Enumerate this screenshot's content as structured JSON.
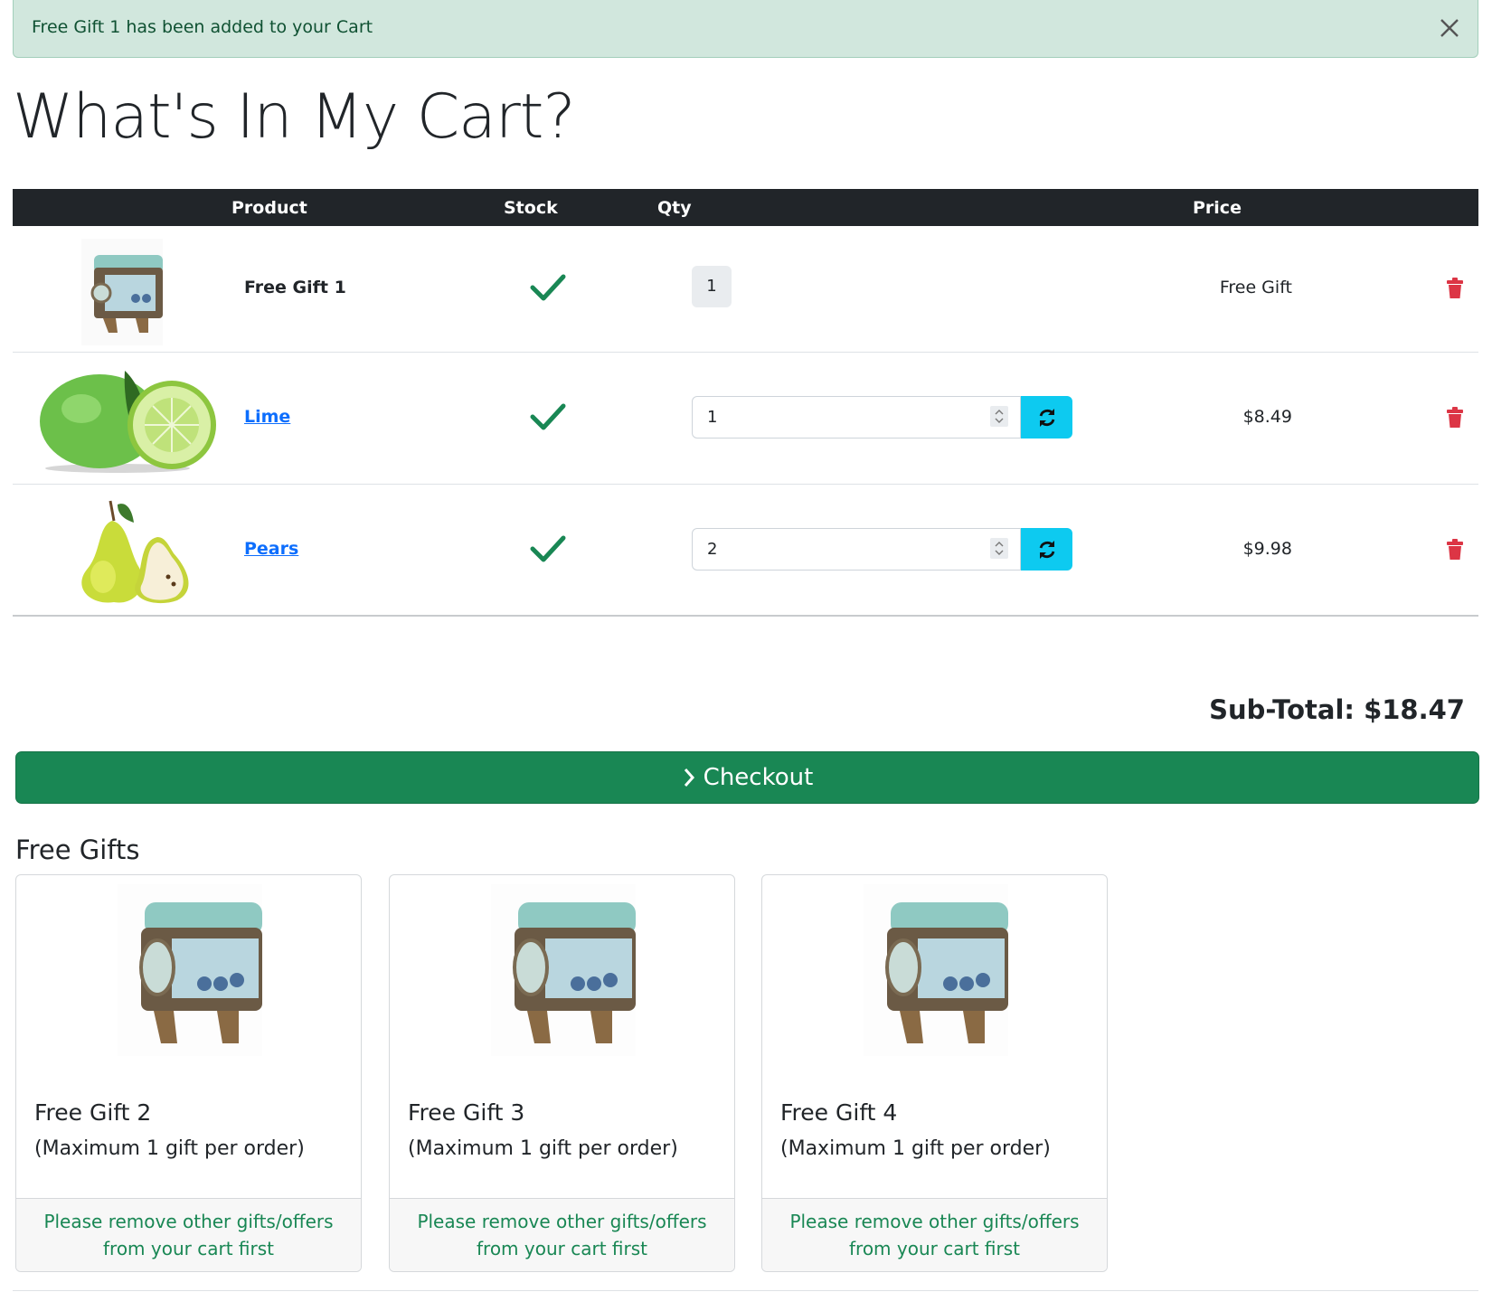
{
  "alert": {
    "message": "Free Gift 1 has been added to your Cart",
    "close_icon": "close-icon"
  },
  "page_title": "What's In My Cart?",
  "table": {
    "headers": {
      "product": "Product",
      "stock": "Stock",
      "qty": "Qty",
      "price": "Price"
    },
    "rows": [
      {
        "name": "Free Gift 1",
        "image": "jewelry-box",
        "in_stock": true,
        "qty": "1",
        "qty_editable": false,
        "price": "Free Gift"
      },
      {
        "name": "Lime",
        "image": "lime",
        "in_stock": true,
        "qty": "1",
        "qty_editable": true,
        "price": "$8.49"
      },
      {
        "name": "Pears",
        "image": "pear",
        "in_stock": true,
        "qty": "2",
        "qty_editable": true,
        "price": "$9.98"
      }
    ]
  },
  "subtotal": "Sub-Total: $18.47",
  "checkout_label": "Checkout",
  "free_gifts": {
    "title": "Free Gifts",
    "cards": [
      {
        "title": "Free Gift 2",
        "subtitle": "(Maximum 1 gift per order)",
        "footer": "Please remove other gifts/offers from your cart first"
      },
      {
        "title": "Free Gift 3",
        "subtitle": "(Maximum 1 gift per order)",
        "footer": "Please remove other gifts/offers from your cart first"
      },
      {
        "title": "Free Gift 4",
        "subtitle": "(Maximum 1 gift per order)",
        "footer": "Please remove other gifts/offers from your cart first"
      }
    ]
  },
  "colors": {
    "success": "#198754",
    "danger": "#dc3545",
    "info": "#0dcaf0",
    "link": "#0d6efd",
    "header_bg": "#212529",
    "alert_bg": "#d1e7dd"
  }
}
